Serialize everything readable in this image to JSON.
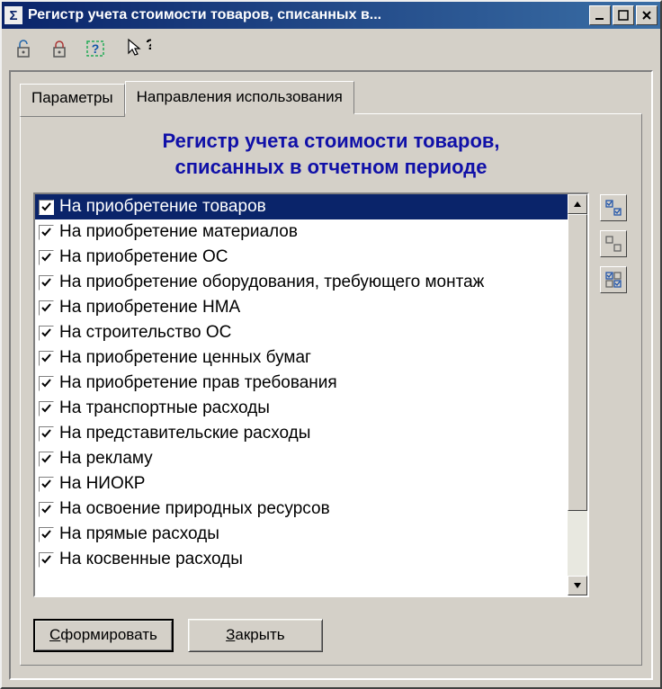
{
  "window": {
    "title": "Регистр учета стоимости товаров, списанных в..."
  },
  "tabs": {
    "parameters": "Параметры",
    "directions": "Направления использования"
  },
  "heading_line1": "Регистр учета стоимости товаров,",
  "heading_line2": "списанных в отчетном периоде",
  "list": {
    "items": [
      {
        "label": "На приобретение товаров",
        "checked": true,
        "selected": true
      },
      {
        "label": "На приобретение материалов",
        "checked": true
      },
      {
        "label": "На приобретение ОС",
        "checked": true
      },
      {
        "label": "На приобретение оборудования, требующего монтаж",
        "checked": true
      },
      {
        "label": "На приобретение НМА",
        "checked": true
      },
      {
        "label": "На строительство ОС",
        "checked": true
      },
      {
        "label": "На приобретение ценных бумаг",
        "checked": true
      },
      {
        "label": "На приобретение прав требования",
        "checked": true
      },
      {
        "label": "На транспортные расходы",
        "checked": true
      },
      {
        "label": "На представительские расходы",
        "checked": true
      },
      {
        "label": "На рекламу",
        "checked": true
      },
      {
        "label": "На НИОКР",
        "checked": true
      },
      {
        "label": "На освоение природных ресурсов",
        "checked": true
      },
      {
        "label": "На прямые расходы",
        "checked": true
      },
      {
        "label": "На косвенные расходы",
        "checked": true
      }
    ]
  },
  "buttons": {
    "generate_pre": "С",
    "generate_rest": "формировать",
    "close_pre": "З",
    "close_rest": "акрыть"
  }
}
